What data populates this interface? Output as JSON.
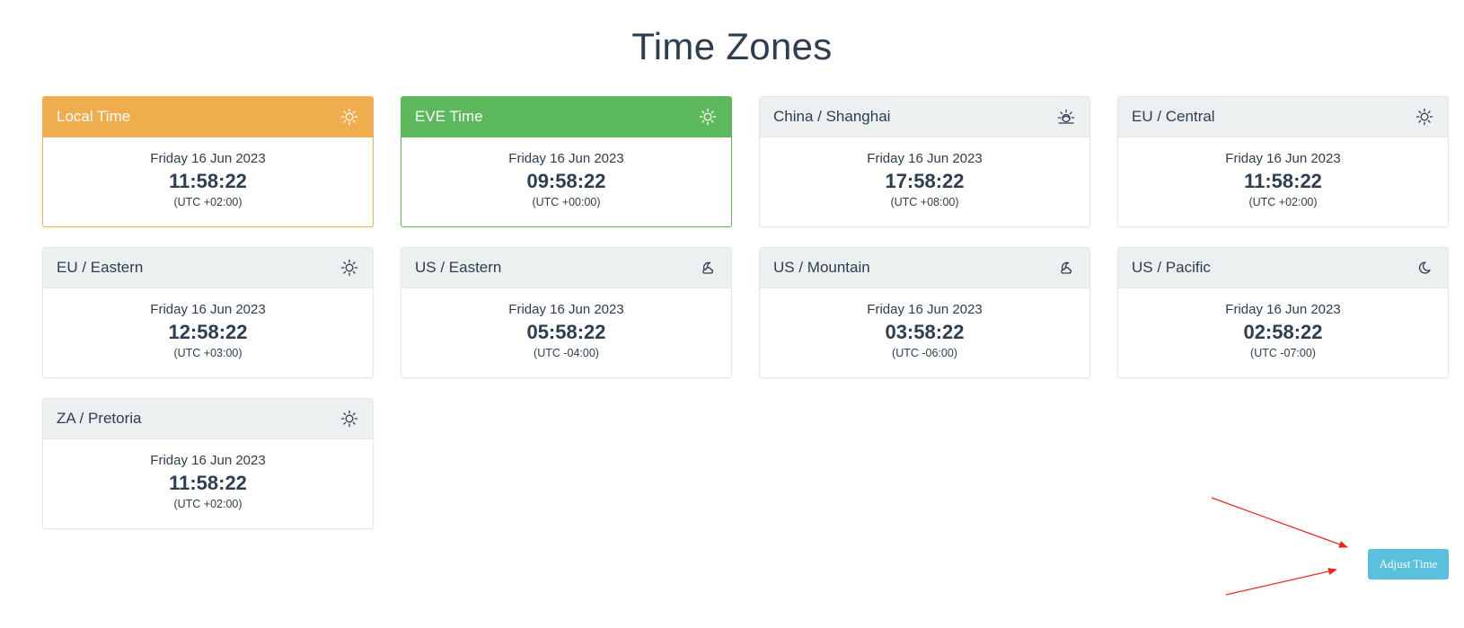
{
  "page": {
    "title": "Time Zones"
  },
  "colors": {
    "warning": "#f0ad4e",
    "success": "#5cb85c",
    "default_header": "#ecf0f1",
    "info_button": "#5bc0de",
    "text": "#2c3e50",
    "arrow": "#e8261c"
  },
  "zones": [
    {
      "name": "Local Time",
      "date": "Friday 16 Jun 2023",
      "time": "11:58:22",
      "offset": "(UTC +02:00)",
      "icon": "sun-icon",
      "style": "warning"
    },
    {
      "name": "EVE Time",
      "date": "Friday 16 Jun 2023",
      "time": "09:58:22",
      "offset": "(UTC +00:00)",
      "icon": "sun-icon",
      "style": "success"
    },
    {
      "name": "China / Shanghai",
      "date": "Friday 16 Jun 2023",
      "time": "17:58:22",
      "offset": "(UTC +08:00)",
      "icon": "sunset-icon",
      "style": "default"
    },
    {
      "name": "EU / Central",
      "date": "Friday 16 Jun 2023",
      "time": "11:58:22",
      "offset": "(UTC +02:00)",
      "icon": "sun-icon",
      "style": "default"
    },
    {
      "name": "EU / Eastern",
      "date": "Friday 16 Jun 2023",
      "time": "12:58:22",
      "offset": "(UTC +03:00)",
      "icon": "sun-icon",
      "style": "default"
    },
    {
      "name": "US / Eastern",
      "date": "Friday 16 Jun 2023",
      "time": "05:58:22",
      "offset": "(UTC -04:00)",
      "icon": "moon-cloud-icon",
      "style": "default"
    },
    {
      "name": "US / Mountain",
      "date": "Friday 16 Jun 2023",
      "time": "03:58:22",
      "offset": "(UTC -06:00)",
      "icon": "moon-cloud-icon",
      "style": "default"
    },
    {
      "name": "US / Pacific",
      "date": "Friday 16 Jun 2023",
      "time": "02:58:22",
      "offset": "(UTC -07:00)",
      "icon": "moon-icon",
      "style": "default"
    },
    {
      "name": "ZA / Pretoria",
      "date": "Friday 16 Jun 2023",
      "time": "11:58:22",
      "offset": "(UTC +02:00)",
      "icon": "sun-icon",
      "style": "default"
    }
  ],
  "actions": {
    "adjust_label": "Adjust Time"
  }
}
